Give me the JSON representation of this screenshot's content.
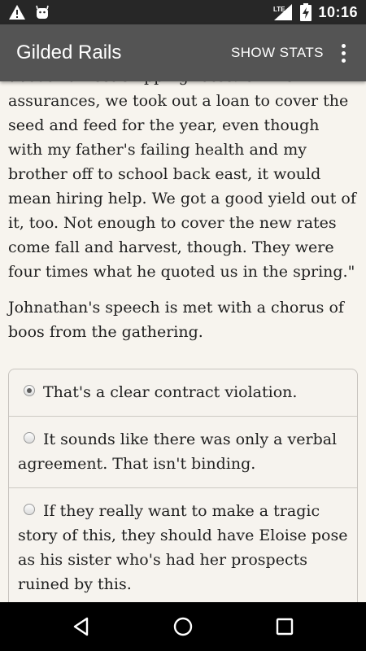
{
  "status_bar": {
    "time": "10:16",
    "network_label": "LTE",
    "icons": [
      "warning-icon",
      "android-icon",
      "lte-signal-icon",
      "battery-charging-icon"
    ]
  },
  "app_bar": {
    "title": "Gilded Rails",
    "show_stats_label": "SHOW STATS",
    "overflow_icon": "more-vert-icon"
  },
  "story": {
    "paragraphs": [
      "about harvest shipping rates. On his assurances, we took out a loan to cover the seed and feed for the year, even though with my father's failing health and my brother off to school back east, it would mean hiring help. We got a good yield out of it, too. Not enough to cover the new rates come fall and harvest, though. They were four times what he quoted us in the spring.\"",
      "Johnathan's speech is met with a chorus of boos from the gathering."
    ]
  },
  "choices": [
    {
      "label": "That's a clear contract violation.",
      "selected": true
    },
    {
      "label": "It sounds like there was only a verbal agreement. That isn't binding.",
      "selected": false
    },
    {
      "label": "If they really want to make a tragic story of this, they should have Eloise pose as his sister who's had her prospects ruined by this.",
      "selected": false
    }
  ],
  "nav_bar": {
    "icons": [
      "back-icon",
      "home-icon",
      "recents-icon"
    ]
  }
}
